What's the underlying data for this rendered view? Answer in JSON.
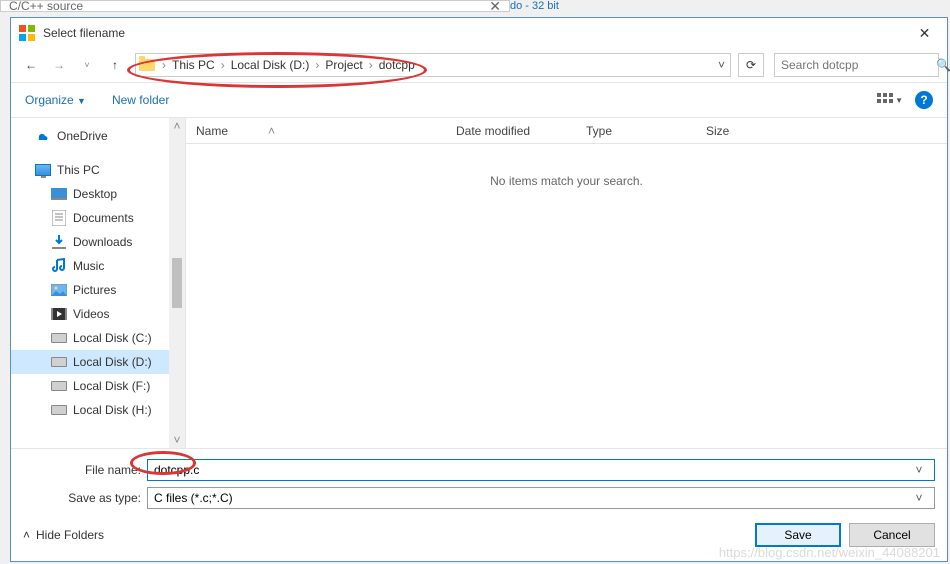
{
  "backWindow": {
    "title": "C/C++ source",
    "scrap": "do - 32 bit"
  },
  "dialog": {
    "title": "Select filename",
    "breadcrumb": [
      "This PC",
      "Local Disk (D:)",
      "Project",
      "dotcpp"
    ],
    "searchPlaceholder": "Search dotcpp",
    "toolbar": {
      "organize": "Organize",
      "newFolder": "New folder"
    },
    "columns": {
      "name": "Name",
      "date": "Date modified",
      "type": "Type",
      "size": "Size"
    },
    "emptyMsg": "No items match your search.",
    "tree": [
      {
        "label": "OneDrive",
        "icon": "onedrive",
        "indent": false
      },
      {
        "label": "This PC",
        "icon": "thispc",
        "indent": false
      },
      {
        "label": "Desktop",
        "icon": "desktop",
        "indent": true
      },
      {
        "label": "Documents",
        "icon": "documents",
        "indent": true
      },
      {
        "label": "Downloads",
        "icon": "downloads",
        "indent": true
      },
      {
        "label": "Music",
        "icon": "music",
        "indent": true
      },
      {
        "label": "Pictures",
        "icon": "pictures",
        "indent": true
      },
      {
        "label": "Videos",
        "icon": "videos",
        "indent": true
      },
      {
        "label": "Local Disk (C:)",
        "icon": "drive",
        "indent": true
      },
      {
        "label": "Local Disk (D:)",
        "icon": "drive",
        "indent": true,
        "selected": true
      },
      {
        "label": "Local Disk (F:)",
        "icon": "drive",
        "indent": true
      },
      {
        "label": "Local Disk (H:)",
        "icon": "drive",
        "indent": true
      }
    ],
    "form": {
      "fileNameLabel": "File name:",
      "fileNameValue": "dotcpp.c",
      "saveTypeLabel": "Save as type:",
      "saveTypeValue": "C files (*.c;*.C)"
    },
    "footer": {
      "hideFolders": "Hide Folders",
      "save": "Save",
      "cancel": "Cancel"
    }
  },
  "watermark": "https://blog.csdn.net/weixin_44088201"
}
